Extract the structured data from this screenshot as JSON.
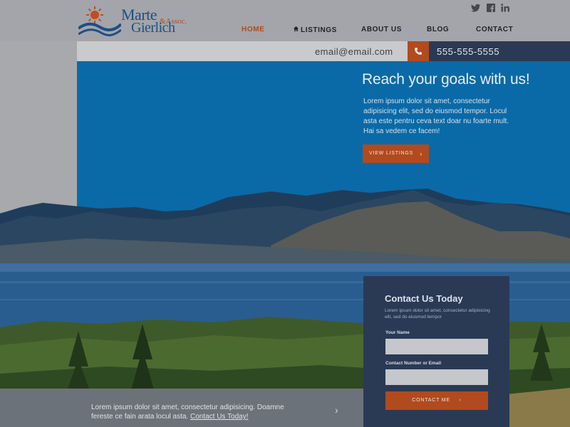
{
  "brand": {
    "name_line1": "Marte",
    "name_amp": "&Assoc.",
    "name_line2": "Gierlich"
  },
  "social": [
    "twitter-icon",
    "facebook-icon",
    "linkedin-icon"
  ],
  "nav": {
    "home": "HOME",
    "listings": "LISTINGS",
    "about": "ABOUT US",
    "blog": "BLOG",
    "contact": "CONTACT"
  },
  "contact_bar": {
    "email": "email@email.com",
    "phone": "555-555-5555"
  },
  "hero": {
    "title": "Reach your goals with us!",
    "text": "Lorem ipsum dolor sit amet, consectetur adipisicing elit, sed do eiusmod tempor. Locul asta este pentru ceva text doar nu foarte mult. Hai sa vedem ce facem!",
    "button": "VIEW LISTINGS"
  },
  "contact_form": {
    "title": "Contact Us Today",
    "subtitle": "Lorem ipsum dolor sit amet, consectetur adipisicing elit, sed do eiusmod tempor",
    "name_label": "Your Name",
    "number_label": "Contact Number or Email",
    "button": "CONTACT ME"
  },
  "bottom": {
    "text": "Lorem ipsum dolor sit amet, consectetur adipisicing. Doamne fereste ce fain arata locul asta.",
    "link": "Contact Us Today!"
  },
  "colors": {
    "accent": "#b14a1f",
    "navy": "#2a3a55",
    "sky": "#0a6aa7"
  }
}
